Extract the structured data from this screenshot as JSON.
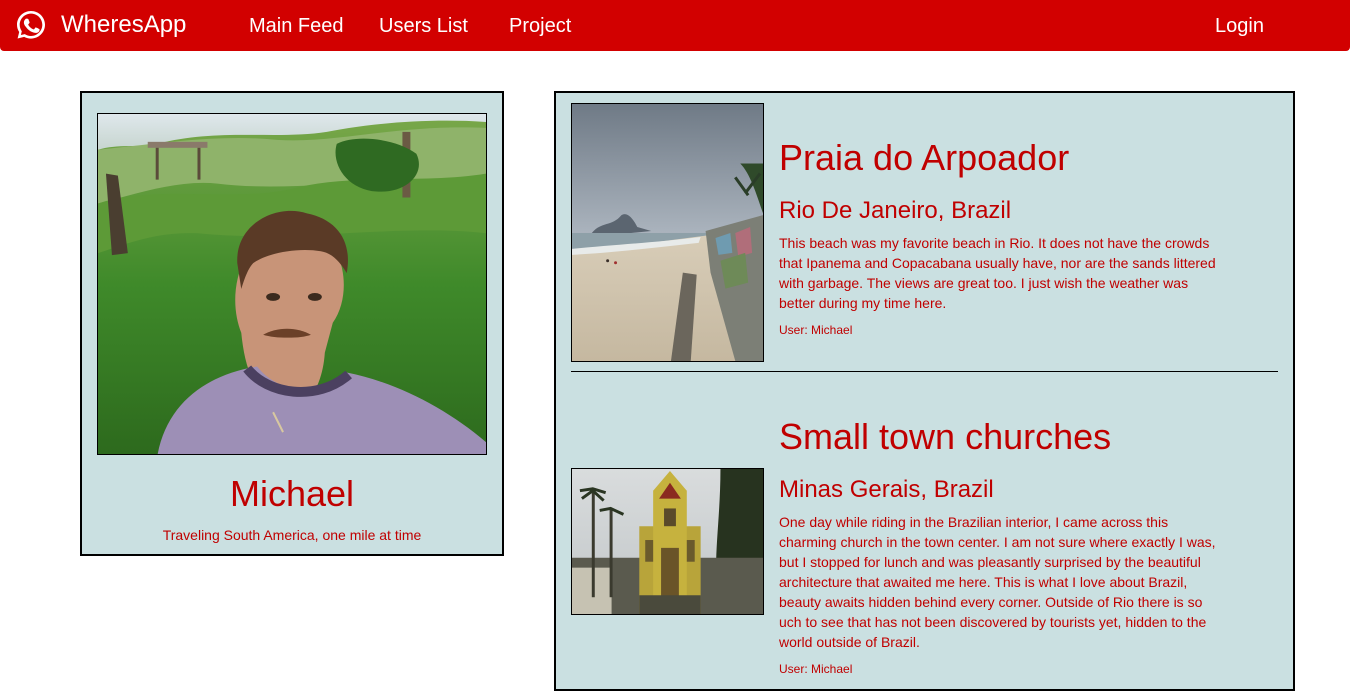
{
  "navbar": {
    "brand": "WheresApp",
    "brand_icon": "whatsapp-phone-icon",
    "links": [
      "Main Feed",
      "Users List",
      "Project"
    ],
    "login_label": "Login",
    "background_color": "#d20000"
  },
  "profile": {
    "name": "Michael",
    "bio": "Traveling South America, one mile at time",
    "photo": "selfie-in-grass-field"
  },
  "posts": [
    {
      "title": "Praia do Arpoador",
      "location": "Rio De Janeiro, Brazil",
      "body": "This beach was my favorite beach in Rio. It does not have the crowds that Ipanema and Copacabana usually have, nor are the sands littered with garbage. The views are great too. I just wish the weather was better during my time here.",
      "user": "User: Michael",
      "photo": "beach-with-graffiti-wall"
    },
    {
      "title": "Small town churches",
      "location": "Minas Gerais, Brazil",
      "body": "One day while riding in the Brazilian interior, I came across this charming church in the town center. I am not sure where exactly I was, but I stopped for lunch and was pleasantly surprised by the beautiful architecture that awaited me here. This is what I love about Brazil, beauty awaits hidden behind every corner. Outside of Rio there is so uch to see that has not been discovered by tourists yet, hidden to the world outside of Brazil.",
      "user": "User: Michael",
      "photo": "yellow-church-with-palms"
    }
  ],
  "colors": {
    "accent": "#c00000",
    "panel_background": "#cae0e1"
  }
}
